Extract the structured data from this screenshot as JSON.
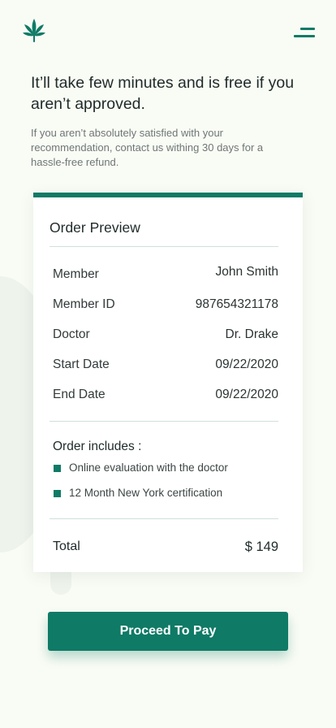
{
  "colors": {
    "accent": "#0f7a66",
    "background": "#f9fcf5",
    "card": "#ffffff",
    "divider": "#cfe0db"
  },
  "header": {
    "logo_icon": "cannabis-leaf-icon",
    "menu_icon": "hamburger-menu-icon"
  },
  "intro": {
    "headline": "It’ll take few minutes and is free if you aren’t approved.",
    "subtext": "If you aren’t absolutely satisfied with your recommendation, contact us withing 30 days for a hassle-free refund."
  },
  "order": {
    "title": "Order Preview",
    "details": [
      {
        "label": "Member",
        "value": "John Smith"
      },
      {
        "label": "Member ID",
        "value": "987654321178"
      },
      {
        "label": "Doctor",
        "value": "Dr. Drake"
      },
      {
        "label": "Start Date",
        "value": "09/22/2020"
      },
      {
        "label": "End Date",
        "value": "09/22/2020"
      }
    ],
    "includes_title": "Order includes :",
    "includes": [
      "Online evaluation with the doctor",
      "12 Month New York certification"
    ],
    "total_label": "Total",
    "total_value": "$ 149"
  },
  "actions": {
    "proceed_label": "Proceed To Pay"
  }
}
